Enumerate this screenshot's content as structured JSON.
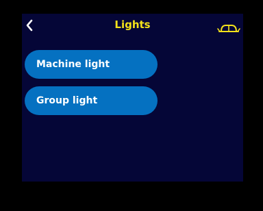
{
  "header": {
    "title": "Lights",
    "back_icon": "chevron-left-icon",
    "right_icon": "machine-outline-icon"
  },
  "menu": {
    "items": [
      {
        "label": "Machine light"
      },
      {
        "label": "Group light"
      }
    ]
  },
  "colors": {
    "background": "#050637",
    "title": "#f4e21a",
    "button": "#0571c1",
    "button_text": "#ffffff"
  }
}
